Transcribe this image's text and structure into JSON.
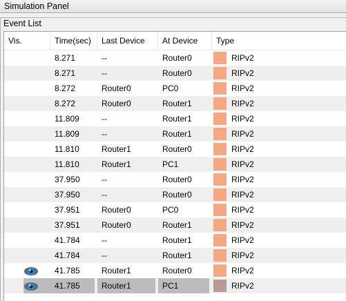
{
  "panel": {
    "title": "Simulation Panel"
  },
  "event_list": {
    "title": "Event List",
    "columns": [
      "Vis.",
      "Time(sec)",
      "Last Device",
      "At Device",
      "Type"
    ],
    "rows": [
      {
        "time": "8.271",
        "last": "--",
        "at": "Router0",
        "type": "RIPv2",
        "visible": false
      },
      {
        "time": "8.271",
        "last": "--",
        "at": "Router0",
        "type": "RIPv2",
        "visible": false
      },
      {
        "time": "8.272",
        "last": "Router0",
        "at": "PC0",
        "type": "RIPv2",
        "visible": false
      },
      {
        "time": "8.272",
        "last": "Router0",
        "at": "Router1",
        "type": "RIPv2",
        "visible": false
      },
      {
        "time": "11.809",
        "last": "--",
        "at": "Router1",
        "type": "RIPv2",
        "visible": false
      },
      {
        "time": "11.809",
        "last": "--",
        "at": "Router1",
        "type": "RIPv2",
        "visible": false
      },
      {
        "time": "11.810",
        "last": "Router1",
        "at": "Router0",
        "type": "RIPv2",
        "visible": false
      },
      {
        "time": "11.810",
        "last": "Router1",
        "at": "PC1",
        "type": "RIPv2",
        "visible": false
      },
      {
        "time": "37.950",
        "last": "--",
        "at": "Router0",
        "type": "RIPv2",
        "visible": false
      },
      {
        "time": "37.950",
        "last": "--",
        "at": "Router0",
        "type": "RIPv2",
        "visible": false
      },
      {
        "time": "37.951",
        "last": "Router0",
        "at": "PC0",
        "type": "RIPv2",
        "visible": false
      },
      {
        "time": "37.951",
        "last": "Router0",
        "at": "Router1",
        "type": "RIPv2",
        "visible": false
      },
      {
        "time": "41.784",
        "last": "--",
        "at": "Router1",
        "type": "RIPv2",
        "visible": false
      },
      {
        "time": "41.784",
        "last": "--",
        "at": "Router1",
        "type": "RIPv2",
        "visible": false
      },
      {
        "time": "41.785",
        "last": "Router1",
        "at": "Router0",
        "type": "RIPv2",
        "visible": true,
        "vis_icon": "eye-icon"
      },
      {
        "time": "41.785",
        "last": "Router1",
        "at": "PC1",
        "type": "RIPv2",
        "visible": true,
        "vis_icon": "eye-icon",
        "selected": true
      }
    ],
    "type_colors": {
      "RIPv2": "#f5a882",
      "selected": "#b99a96"
    }
  }
}
